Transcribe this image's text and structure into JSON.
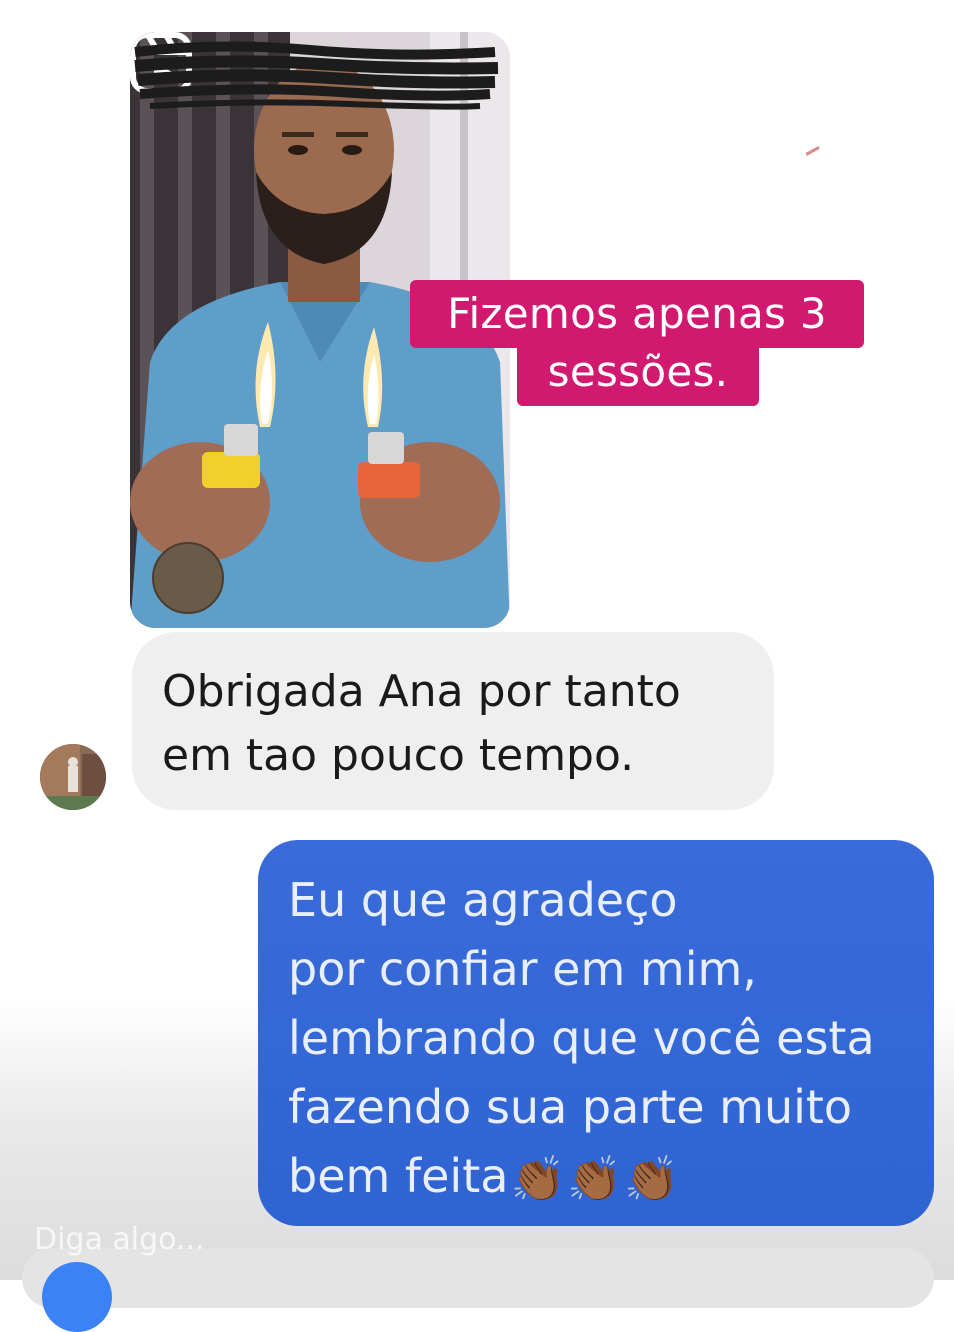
{
  "shared_reel": {
    "caption_line1": "Fizemos apenas 3",
    "caption_line2": "sessões.",
    "reel_icon": "reels-icon",
    "caption_color": "#d11a6f"
  },
  "received": {
    "line1": "Obrigada Ana por tanto",
    "line2": "em tao pouco tempo.",
    "bubble_color": "#efefef"
  },
  "sent": {
    "lines": [
      "Eu que agradeço",
      "por confiar em mim,",
      "lembrando que você esta",
      "fazendo sua parte muito"
    ],
    "last_line": "bem feita",
    "emoji": "👏🏾",
    "bubble_color": "#3468d6"
  },
  "composer": {
    "placeholder": "Diga algo..."
  }
}
